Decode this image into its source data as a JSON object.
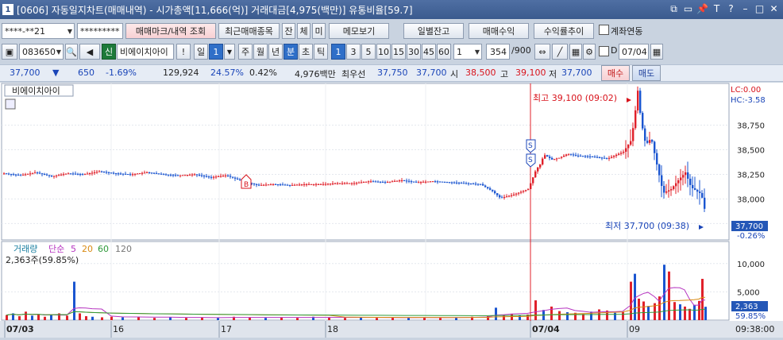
{
  "window": {
    "number": "1",
    "title": "[0606] 자동일지차트(매매내역) - 시가총액[11,666(억)] 거래대금[4,975(백만)] 유통비율[59.7]"
  },
  "toolbar1": {
    "account": "****-**21",
    "password": "*********",
    "trade_mark_btn": "매매마크/내역 조회",
    "recent_btn": "최근매매종목",
    "jan": "잔",
    "che": "체",
    "mi": "미",
    "memo_btn": "메모보기",
    "daily_balance_btn": "일별잔고",
    "trade_profit_btn": "매매수익",
    "profit_trend_btn": "수익률추이",
    "link_account_label": "계좌연동"
  },
  "toolbar2": {
    "code": "083650",
    "sin": "신",
    "stock_name": "비에이치아이",
    "alert": "!",
    "period_label": "일",
    "period_value": "1",
    "periods": [
      "주",
      "월",
      "년",
      "분",
      "초",
      "틱"
    ],
    "intervals": [
      "1",
      "3",
      "5",
      "10",
      "15",
      "30",
      "45",
      "60"
    ],
    "interval_value": "1",
    "count": "354",
    "count_total": "/900",
    "d_label": "D",
    "date": "07/04"
  },
  "quote": {
    "price": "37,700",
    "down_arrow": "▼",
    "change": "650",
    "change_pct": "-1.69%",
    "volume": "129,924",
    "turnover": "24.57%",
    "ratio": "0.42%",
    "amount": "4,976백만",
    "best_label": "최우선",
    "ask": "37,750",
    "bid": "37,700",
    "open_label": "시",
    "open": "38,500",
    "high_label": "고",
    "high": "39,100",
    "low_label": "저",
    "low": "37,700",
    "buy_btn": "매수",
    "sell_btn": "매도"
  },
  "chart_data": {
    "type": "candlestick",
    "price_panel": {
      "label": "비에이치아이",
      "lc": "LC:0.00",
      "hc": "HC:-3.58",
      "y_ticks": [
        "38,750",
        "38,500",
        "38,250",
        "38,000",
        "37,750"
      ],
      "ylim": [
        37600,
        39150
      ],
      "high_annotation": "최고 39,100 (09:02)",
      "low_annotation": "최저 37,700 (09:38)",
      "last_price_tag": "37,700",
      "last_pct_tag": "-0.26%",
      "trade_marks": [
        "B",
        "S",
        "S"
      ]
    },
    "volume_panel": {
      "legend": [
        "거래량",
        "단순",
        "5",
        "20",
        "60",
        "120"
      ],
      "current_volume_label": "2,363주(59.85%)",
      "y_ticks": [
        "10,000",
        "5,000"
      ],
      "last_volume_tag": "2,363",
      "last_pct_tag": "59.85%",
      "ylim": [
        0,
        12500
      ]
    },
    "x_labels": [
      "07/03",
      "16",
      "17",
      "18",
      "07/04",
      "09"
    ],
    "time_label": "09:38:00",
    "price_path": [
      [
        0,
        38260
      ],
      [
        20,
        38240
      ],
      [
        40,
        38270
      ],
      [
        60,
        38230
      ],
      [
        80,
        38260
      ],
      [
        100,
        38250
      ],
      [
        120,
        38280
      ],
      [
        140,
        38260
      ],
      [
        160,
        38250
      ],
      [
        180,
        38270
      ],
      [
        200,
        38250
      ],
      [
        220,
        38240
      ],
      [
        240,
        38250
      ],
      [
        260,
        38220
      ],
      [
        280,
        38240
      ],
      [
        300,
        38180
      ],
      [
        320,
        38140
      ],
      [
        340,
        38150
      ],
      [
        360,
        38140
      ],
      [
        380,
        38150
      ],
      [
        400,
        38150
      ],
      [
        420,
        38160
      ],
      [
        440,
        38160
      ],
      [
        460,
        38180
      ],
      [
        480,
        38170
      ],
      [
        500,
        38190
      ],
      [
        520,
        38170
      ],
      [
        540,
        38180
      ],
      [
        560,
        38170
      ],
      [
        580,
        38160
      ],
      [
        600,
        38150
      ],
      [
        615,
        38080
      ],
      [
        625,
        38010
      ],
      [
        640,
        38040
      ],
      [
        660,
        38100
      ],
      [
        670,
        38300
      ],
      [
        675,
        38350
      ],
      [
        680,
        38450
      ],
      [
        690,
        38400
      ],
      [
        700,
        38420
      ],
      [
        710,
        38460
      ],
      [
        720,
        38440
      ],
      [
        740,
        38430
      ],
      [
        760,
        38410
      ],
      [
        780,
        38480
      ],
      [
        790,
        38600
      ],
      [
        795,
        38900
      ],
      [
        798,
        39100
      ],
      [
        802,
        38800
      ],
      [
        808,
        38550
      ],
      [
        815,
        38620
      ],
      [
        822,
        38350
      ],
      [
        830,
        38060
      ],
      [
        840,
        38100
      ],
      [
        850,
        38200
      ],
      [
        858,
        38270
      ],
      [
        865,
        38120
      ],
      [
        872,
        38080
      ],
      [
        878,
        38050
      ],
      [
        882,
        37900
      ],
      [
        886,
        37700
      ]
    ],
    "volume_bars": [
      [
        4,
        900
      ],
      [
        12,
        1200
      ],
      [
        20,
        700
      ],
      [
        28,
        1500
      ],
      [
        36,
        800
      ],
      [
        44,
        1000
      ],
      [
        52,
        600
      ],
      [
        60,
        900
      ],
      [
        70,
        1200
      ],
      [
        80,
        800
      ],
      [
        89,
        6800
      ],
      [
        96,
        1200
      ],
      [
        104,
        700
      ],
      [
        112,
        600
      ],
      [
        124,
        500
      ],
      [
        136,
        600
      ],
      [
        150,
        500
      ],
      [
        170,
        600
      ],
      [
        190,
        400
      ],
      [
        210,
        500
      ],
      [
        230,
        400
      ],
      [
        250,
        500
      ],
      [
        270,
        400
      ],
      [
        290,
        600
      ],
      [
        310,
        500
      ],
      [
        330,
        400
      ],
      [
        350,
        500
      ],
      [
        370,
        400
      ],
      [
        390,
        600
      ],
      [
        410,
        500
      ],
      [
        430,
        400
      ],
      [
        450,
        500
      ],
      [
        470,
        400
      ],
      [
        490,
        500
      ],
      [
        510,
        400
      ],
      [
        530,
        500
      ],
      [
        550,
        400
      ],
      [
        570,
        500
      ],
      [
        590,
        600
      ],
      [
        610,
        700
      ],
      [
        620,
        2200
      ],
      [
        630,
        800
      ],
      [
        640,
        1100
      ],
      [
        650,
        900
      ],
      [
        660,
        1000
      ],
      [
        670,
        3500
      ],
      [
        680,
        1800
      ],
      [
        690,
        2400
      ],
      [
        700,
        1600
      ],
      [
        710,
        1400
      ],
      [
        720,
        1300
      ],
      [
        730,
        1100
      ],
      [
        740,
        1500
      ],
      [
        750,
        1900
      ],
      [
        760,
        1700
      ],
      [
        770,
        1300
      ],
      [
        780,
        1400
      ],
      [
        790,
        6800
      ],
      [
        795,
        8200
      ],
      [
        800,
        3800
      ],
      [
        806,
        3300
      ],
      [
        812,
        2500
      ],
      [
        820,
        3000
      ],
      [
        826,
        4200
      ],
      [
        832,
        9800
      ],
      [
        838,
        8600
      ],
      [
        845,
        3200
      ],
      [
        852,
        2800
      ],
      [
        858,
        2400
      ],
      [
        864,
        2000
      ],
      [
        870,
        2700
      ],
      [
        876,
        3400
      ],
      [
        880,
        7300
      ],
      [
        884,
        2363
      ]
    ]
  }
}
